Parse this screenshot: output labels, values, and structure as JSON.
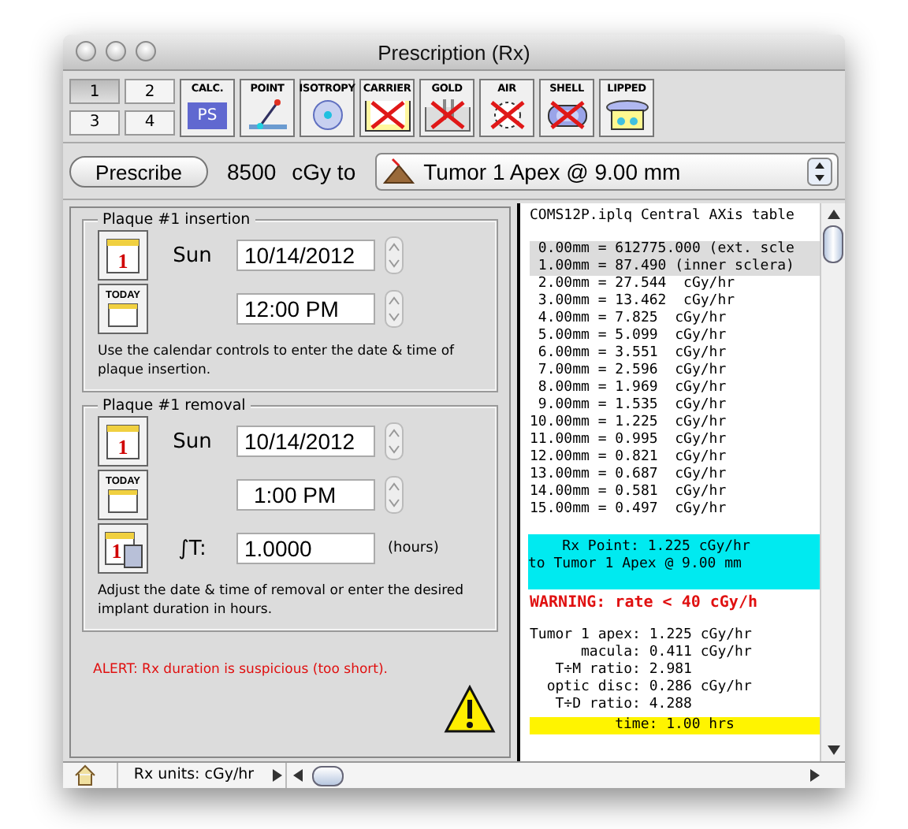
{
  "window": {
    "title": "Prescription (Rx)"
  },
  "toolbar": {
    "pages": [
      {
        "label": "1",
        "selected": true
      },
      {
        "label": "2",
        "selected": false
      },
      {
        "label": "3",
        "selected": false
      },
      {
        "label": "4",
        "selected": false
      }
    ],
    "tools": [
      {
        "label": "CALC.",
        "kind": "calc",
        "text": "PS",
        "crossed": false
      },
      {
        "label": "POINT",
        "kind": "point",
        "crossed": false
      },
      {
        "label": "ISOTROPY",
        "kind": "isotropy",
        "crossed": false
      },
      {
        "label": "CARRIER",
        "kind": "carrier",
        "crossed": true
      },
      {
        "label": "GOLD",
        "kind": "gold",
        "crossed": true
      },
      {
        "label": "AIR",
        "kind": "air",
        "crossed": true
      },
      {
        "label": "SHELL",
        "kind": "shell",
        "crossed": true
      },
      {
        "label": "LIPPED",
        "kind": "lipped",
        "crossed": false
      }
    ]
  },
  "prescription": {
    "button": "Prescribe",
    "dose": "8500",
    "unit": "cGy to",
    "target": "Tumor 1 Apex @ 9.00 mm"
  },
  "insertion": {
    "legend": "Plaque #1 insertion",
    "calendar_digit": "1",
    "today": "TODAY",
    "day": "Sun",
    "date": "10/14/2012",
    "time": "12:00 PM",
    "note": "Use the calendar controls to enter the date & time of plaque insertion."
  },
  "removal": {
    "legend": "Plaque #1 removal",
    "calendar_digit": "1",
    "today": "TODAY",
    "day": "Sun",
    "date": "10/14/2012",
    "time": "1:00 PM",
    "duration_digit": "1",
    "duration_label": "∫T:",
    "duration": "1.0000",
    "duration_unit": "(hours)",
    "note": "Adjust the date & time of removal or enter the desired implant duration in hours."
  },
  "alert": "ALERT: Rx duration is suspicious (too short).",
  "table": {
    "title": "COMS12P.iplq Central AXis table",
    "rows": [
      {
        "text": " 0.00mm = 612775.000 (ext. scle",
        "selected": true
      },
      {
        "text": " 1.00mm = 87.490 (inner sclera)",
        "selected": true
      },
      {
        "text": " 2.00mm = 27.544  cGy/hr",
        "selected": false
      },
      {
        "text": " 3.00mm = 13.462  cGy/hr",
        "selected": false
      },
      {
        "text": " 4.00mm = 7.825  cGy/hr",
        "selected": false
      },
      {
        "text": " 5.00mm = 5.099  cGy/hr",
        "selected": false
      },
      {
        "text": " 6.00mm = 3.551  cGy/hr",
        "selected": false
      },
      {
        "text": " 7.00mm = 2.596  cGy/hr",
        "selected": false
      },
      {
        "text": " 8.00mm = 1.969  cGy/hr",
        "selected": false
      },
      {
        "text": " 9.00mm = 1.535  cGy/hr",
        "selected": false
      },
      {
        "text": "10.00mm = 1.225  cGy/hr",
        "selected": false
      },
      {
        "text": "11.00mm = 0.995  cGy/hr",
        "selected": false
      },
      {
        "text": "12.00mm = 0.821  cGy/hr",
        "selected": false
      },
      {
        "text": "13.00mm = 0.687  cGy/hr",
        "selected": false
      },
      {
        "text": "14.00mm = 0.581  cGy/hr",
        "selected": false
      },
      {
        "text": "15.00mm = 0.497  cGy/hr",
        "selected": false
      }
    ],
    "rx_point": [
      "    Rx Point: 1.225 cGy/hr",
      "to Tumor 1 Apex @ 9.00 mm"
    ],
    "warning": "WARNING: rate < 40 cGy/h",
    "summary": [
      "Tumor 1 apex: 1.225 cGy/hr",
      "      macula: 0.411 cGy/hr",
      "   T÷M ratio: 2.981",
      "  optic disc: 0.286 cGy/hr",
      "   T÷D ratio: 4.288"
    ],
    "time": "time: 1.00 hrs"
  },
  "status_bar": {
    "units": "Rx units: cGy/hr"
  }
}
